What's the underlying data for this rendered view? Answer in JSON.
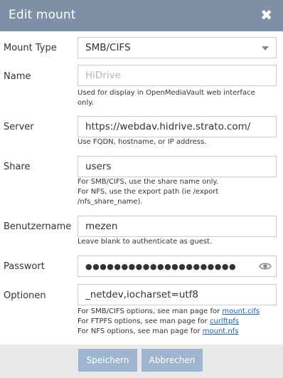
{
  "dialog": {
    "title": "Edit mount",
    "close_glyph": "✖",
    "close_icon": "close-icon"
  },
  "fields": {
    "mount_type": {
      "label": "Mount Type",
      "value": "SMB/CIFS"
    },
    "name": {
      "label": "Name",
      "placeholder": "HiDrive",
      "help": [
        "Used for display in OpenMediaVault web interface",
        "only."
      ]
    },
    "server": {
      "label": "Server",
      "value": "https://webdav.hidrive.strato.com/",
      "help": [
        "Use FQDN, hostname, or IP address."
      ]
    },
    "share": {
      "label": "Share",
      "value": "users",
      "help": [
        "For SMB/CIFS, use the share name only.",
        "For NFS, use the export path (ie /export",
        "/nfs_share_name)."
      ]
    },
    "username": {
      "label": "Benutzername",
      "value": "mezen",
      "help": [
        "Leave blank to authenticate as guest."
      ]
    },
    "password": {
      "label": "Passwort",
      "value": "●●●●●●●●●●●●●●●●●●●●●",
      "toggle_icon": "eye-icon"
    },
    "options": {
      "label": "Optionen",
      "value": "_netdev,iocharset=utf8",
      "help": [
        {
          "text": "For SMB/CIFS options, see man page for ",
          "link": "mount.cifs"
        },
        {
          "text": "For FTPFS options, see man page for ",
          "link": "curlftpfs"
        },
        {
          "text": "For NFS options, see man page for ",
          "link": "mount.nfs"
        }
      ]
    }
  },
  "buttons": {
    "save": "Speichern",
    "cancel": "Abbrechen"
  },
  "colors": {
    "titlebar": "#7f8fa6",
    "button": "#9db5cf",
    "link": "#1a5fa8",
    "footer": "#e9e9e9"
  }
}
